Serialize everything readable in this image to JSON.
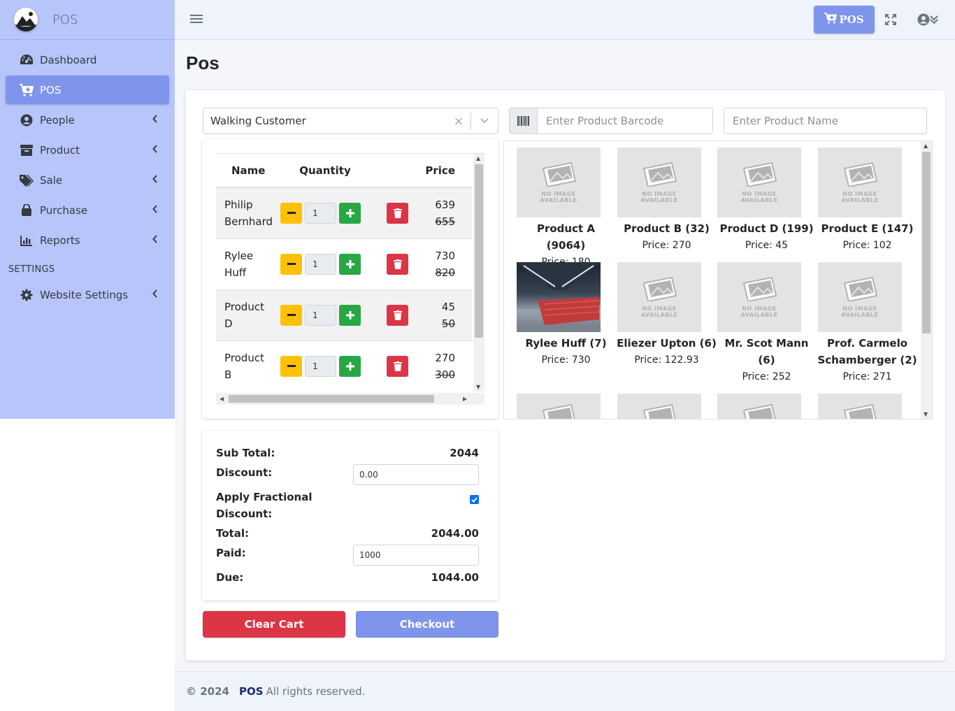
{
  "brand": {
    "name": "POS"
  },
  "sidebar": {
    "items": [
      {
        "label": "Dashboard",
        "icon": "dashboard-icon",
        "active": false,
        "has_submenu": false
      },
      {
        "label": "POS",
        "icon": "cart-plus-icon",
        "active": true,
        "has_submenu": false
      },
      {
        "label": "People",
        "icon": "user-circle-icon",
        "active": false,
        "has_submenu": true
      },
      {
        "label": "Product",
        "icon": "box-icon",
        "active": false,
        "has_submenu": true
      },
      {
        "label": "Sale",
        "icon": "tags-icon",
        "active": false,
        "has_submenu": true
      },
      {
        "label": "Purchase",
        "icon": "shopping-bag-icon",
        "active": false,
        "has_submenu": true
      },
      {
        "label": "Reports",
        "icon": "chart-bar-icon",
        "active": false,
        "has_submenu": true
      }
    ],
    "settings_header": "SETTINGS",
    "settings_items": [
      {
        "label": "Website Settings",
        "icon": "gear-icon",
        "has_submenu": true
      }
    ]
  },
  "topbar": {
    "pos_button": "POS"
  },
  "page": {
    "title": "Pos"
  },
  "customer_select": {
    "value": "Walking Customer"
  },
  "barcode_input": {
    "placeholder": "Enter Product Barcode"
  },
  "name_input": {
    "placeholder": "Enter Product Name"
  },
  "cart": {
    "headers": {
      "name": "Name",
      "quantity": "Quantity",
      "price": "Price"
    },
    "rows": [
      {
        "name_line1": "Philip",
        "name_line2": "Bernhard",
        "qty": "1",
        "price": "639",
        "old_price": "655"
      },
      {
        "name_line1": "Rylee",
        "name_line2": "Huff",
        "qty": "1",
        "price": "730",
        "old_price": "820"
      },
      {
        "name_line1": "Product",
        "name_line2": "D",
        "qty": "1",
        "price": "45",
        "old_price": "50"
      },
      {
        "name_line1": "Product",
        "name_line2": "B",
        "qty": "1",
        "price": "270",
        "old_price": "300"
      }
    ]
  },
  "products": {
    "no_image_text_1": "NO IMAGE",
    "no_image_text_2": "AVAILABLE",
    "items": [
      {
        "name": "Product A (9064)",
        "price": "Price: 180",
        "image": "no-image"
      },
      {
        "name": "Product B (32)",
        "price": "Price: 270",
        "image": "no-image"
      },
      {
        "name": "Product D (199)",
        "price": "Price: 45",
        "image": "no-image"
      },
      {
        "name": "Product E (147)",
        "price": "Price: 102",
        "image": "no-image"
      },
      {
        "name": "Rylee Huff (7)",
        "price": "Price: 730",
        "image": "shopping-carts-photo"
      },
      {
        "name": "Eliezer Upton (6)",
        "price": "Price: 122.93",
        "image": "no-image"
      },
      {
        "name": "Mr. Scot Mann (6)",
        "price": "Price: 252",
        "image": "no-image"
      },
      {
        "name_line1": "Prof. Carmelo",
        "name_line2": "Schamberger (2)",
        "price": "Price: 271",
        "image": "no-image"
      }
    ]
  },
  "summary": {
    "subtotal_label": "Sub Total:",
    "subtotal_value": "2044",
    "discount_label": "Discount:",
    "discount_value": "0.00",
    "fractional_label_line1": "Apply Fractional",
    "fractional_label_line2": "Discount:",
    "fractional_checked": true,
    "total_label": "Total:",
    "total_value": "2044.00",
    "paid_label": "Paid:",
    "paid_value": "1000",
    "due_label": "Due:",
    "due_value": "1044.00"
  },
  "actions": {
    "clear_cart": "Clear Cart",
    "checkout": "Checkout"
  },
  "footer": {
    "copyright": "© 2024",
    "brand": "POS",
    "rights": "All rights reserved."
  },
  "colors": {
    "sidebar_bg": "#b8c5fb",
    "accent": "#7f95ec",
    "danger": "#dc3545",
    "warning": "#ffc107",
    "success": "#28a745"
  }
}
